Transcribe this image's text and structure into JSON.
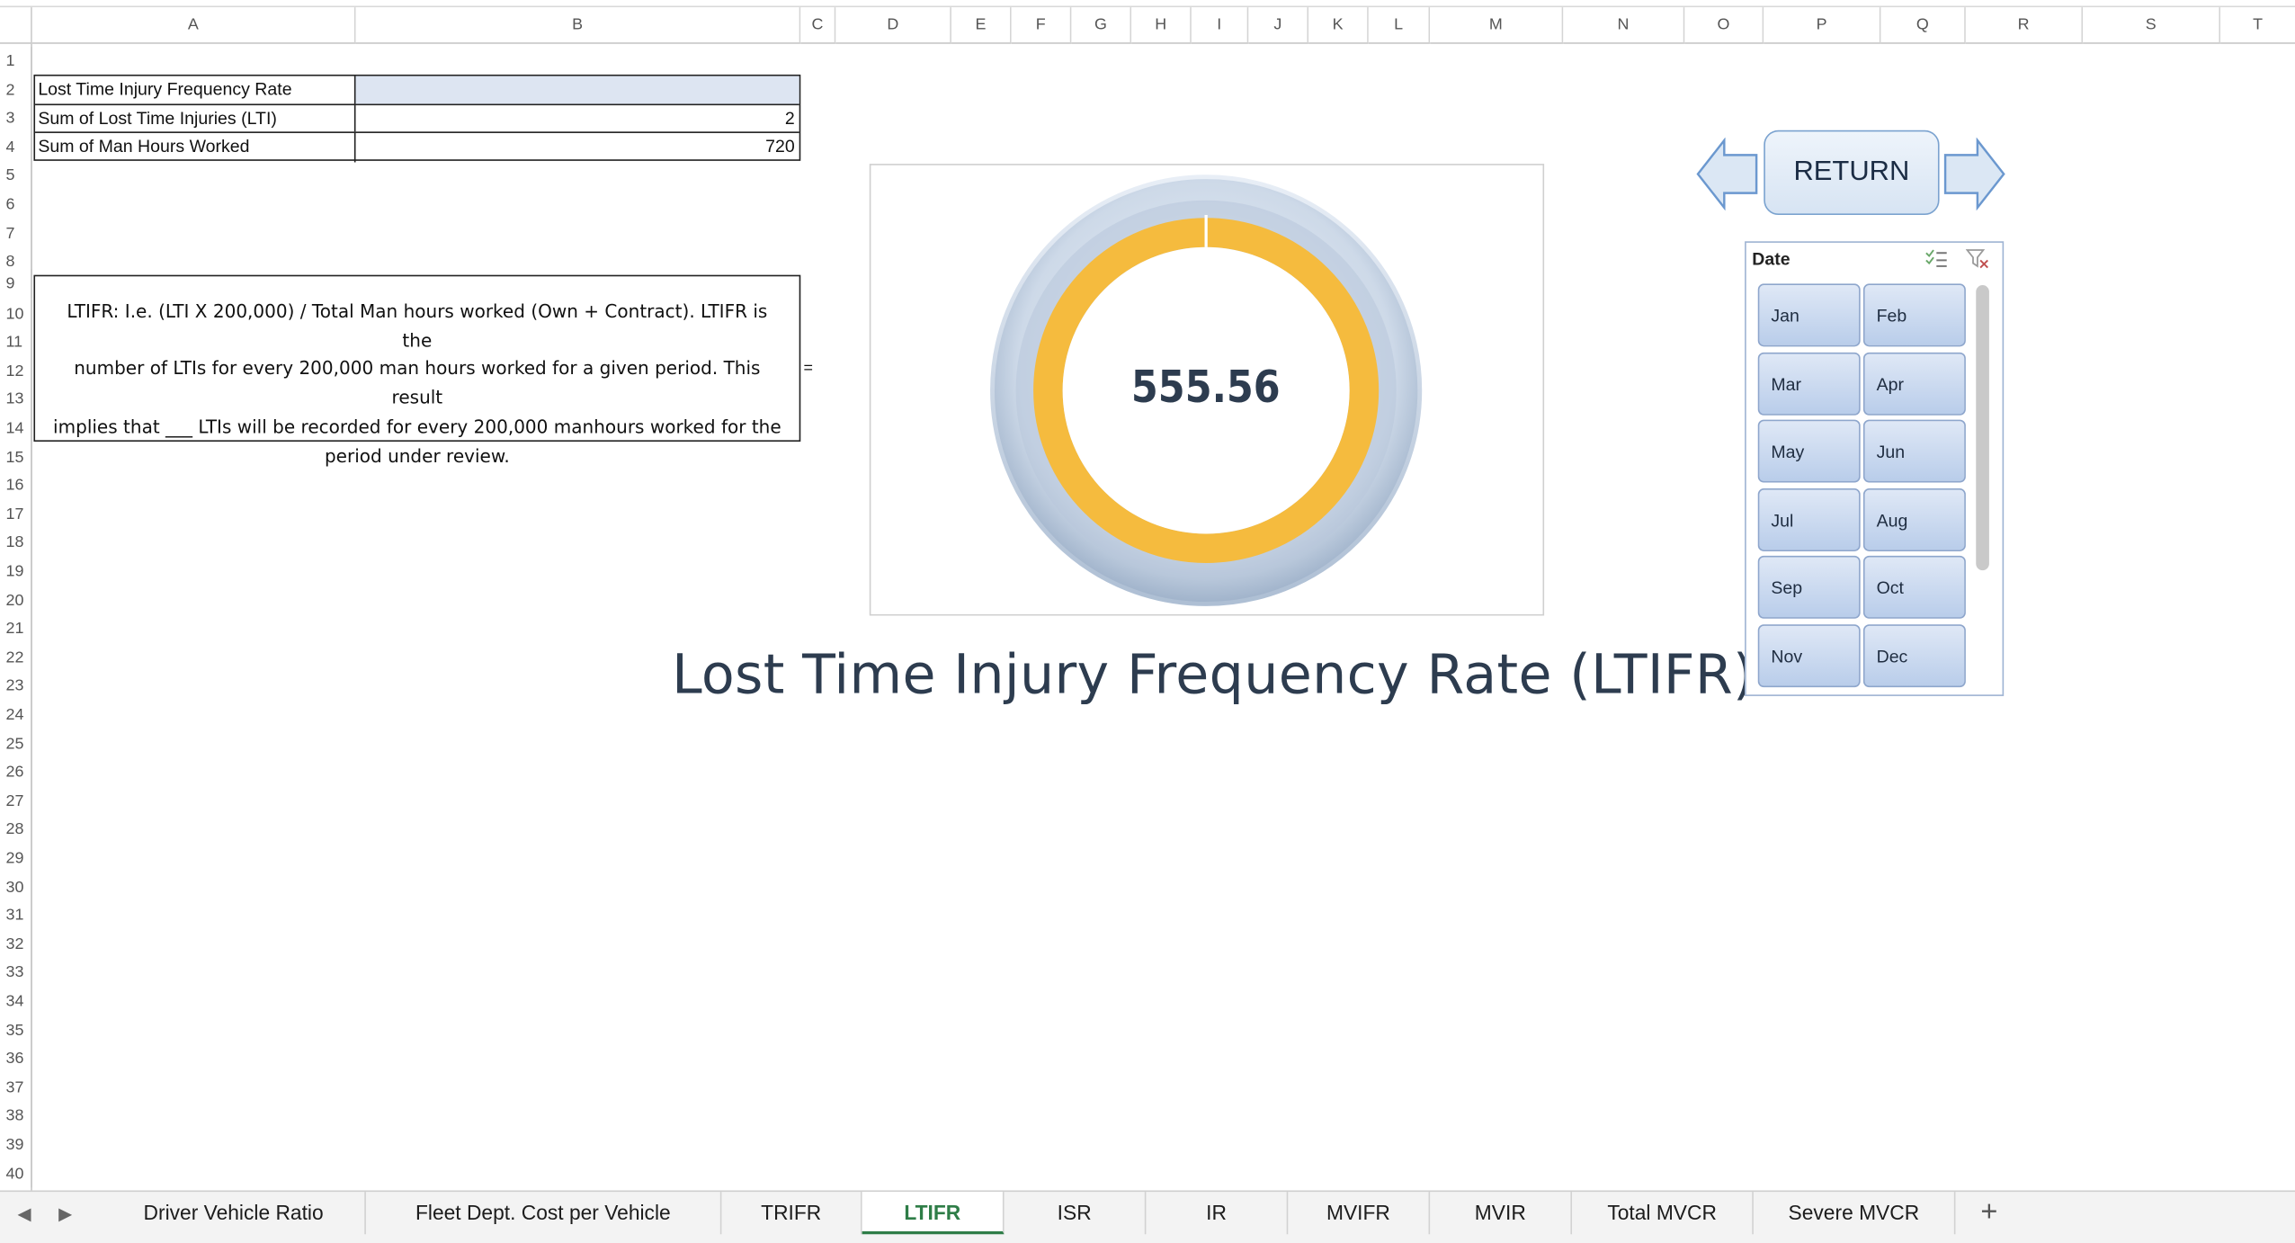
{
  "columns": [
    "A",
    "B",
    "C",
    "D",
    "E",
    "F",
    "G",
    "H",
    "I",
    "J",
    "K",
    "L",
    "M",
    "N",
    "O",
    "P",
    "Q",
    "R",
    "S",
    "T"
  ],
  "rows": [
    "1",
    "2",
    "3",
    "4",
    "5",
    "6",
    "7",
    "8",
    "9",
    "10",
    "11",
    "12",
    "13",
    "14",
    "15",
    "16",
    "17",
    "18",
    "19",
    "20",
    "21",
    "22",
    "23",
    "24",
    "25",
    "26",
    "27",
    "28",
    "29",
    "30",
    "31",
    "32",
    "33",
    "34",
    "35",
    "36",
    "37",
    "38",
    "39",
    "40"
  ],
  "table": {
    "header": "Lost Time Injury Frequency Rate",
    "rows": [
      {
        "label": "Sum of Lost Time Injuries  (LTI)",
        "value": "2"
      },
      {
        "label": "Sum of Man Hours Worked",
        "value": "720"
      }
    ]
  },
  "note": {
    "lines": [
      "LTIFR: I.e. (LTI X 200,000) / Total Man hours worked (Own + Contract). LTIFR is the",
      "number of LTIs for every 200,000 man hours worked for a given period. This result",
      "implies that ___ LTIs will be recorded for every 200,000 manhours worked for the",
      "period under review."
    ],
    "equals": "="
  },
  "gauge": {
    "value_text": "555.56",
    "fill_fraction": 0.999,
    "title": "Lost Time Injury Frequency Rate (LTIFR)",
    "colors": {
      "fill": "#f5bb3e",
      "bezel": "#c9d8e9",
      "text": "#2d3c4f"
    }
  },
  "return_button": {
    "label": "RETURN"
  },
  "slicer": {
    "title": "Date",
    "items": [
      "Jan",
      "Feb",
      "Mar",
      "Apr",
      "May",
      "Jun",
      "Jul",
      "Aug",
      "Sep",
      "Oct",
      "Nov",
      "Dec"
    ]
  },
  "tabs": [
    {
      "label": "Driver Vehicle Ratio",
      "active": false
    },
    {
      "label": "Fleet Dept. Cost per Vehicle",
      "active": false
    },
    {
      "label": "TRIFR",
      "active": false
    },
    {
      "label": "LTIFR",
      "active": true
    },
    {
      "label": "ISR",
      "active": false
    },
    {
      "label": "IR",
      "active": false
    },
    {
      "label": "MVIFR",
      "active": false
    },
    {
      "label": "MVIR",
      "active": false
    },
    {
      "label": "Total MVCR",
      "active": false
    },
    {
      "label": "Severe MVCR",
      "active": false
    }
  ]
}
